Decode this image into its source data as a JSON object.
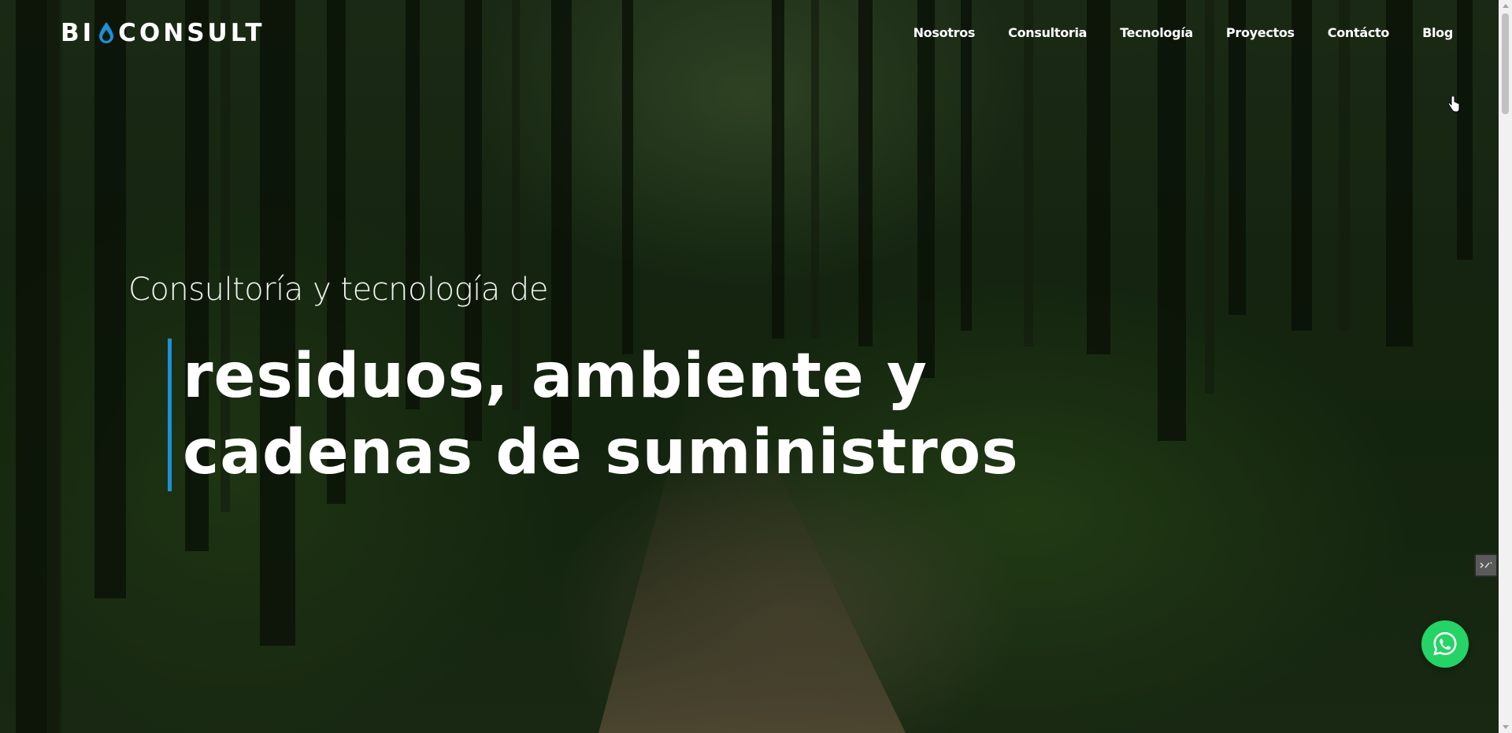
{
  "brand": {
    "logo_left": "BI",
    "logo_right": "CONSULT",
    "accent_color": "#1e90d6"
  },
  "nav": {
    "items": [
      {
        "label": "Nosotros"
      },
      {
        "label": "Consultoria"
      },
      {
        "label": "Tecnología"
      },
      {
        "label": "Proyectos"
      },
      {
        "label": "Contácto"
      },
      {
        "label": "Blog"
      }
    ]
  },
  "hero": {
    "subtitle": "Consultoría y tecnología de",
    "headline_line1": "residuos, ambiente y",
    "headline_line2": "cadenas de suministros",
    "background": "forest-path-photo"
  },
  "widgets": {
    "whatsapp_icon": "whatsapp-icon",
    "whatsapp_color": "#25d366",
    "side_icon": "code-widget-icon"
  }
}
